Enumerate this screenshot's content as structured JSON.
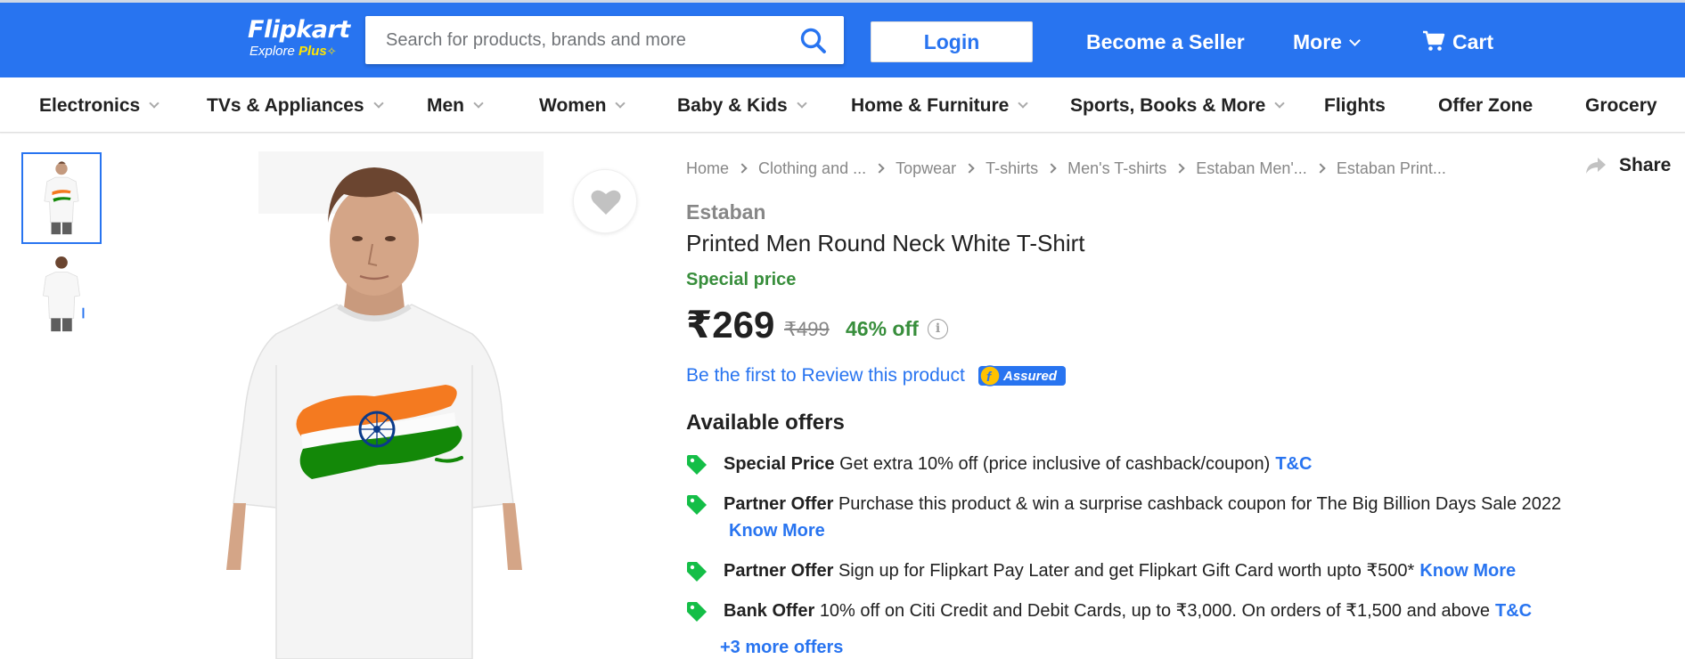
{
  "header": {
    "logo_text": "Flipkart",
    "logo_sub": "Explore",
    "logo_plus": "Plus",
    "search_placeholder": "Search for products, brands and more",
    "login_label": "Login",
    "seller_label": "Become a Seller",
    "more_label": "More",
    "cart_label": "Cart",
    "brand_color": "#2874f0"
  },
  "categories": [
    {
      "label": "Electronics",
      "dropdown": true
    },
    {
      "label": "TVs & Appliances",
      "dropdown": true
    },
    {
      "label": "Men",
      "dropdown": true
    },
    {
      "label": "Women",
      "dropdown": true
    },
    {
      "label": "Baby & Kids",
      "dropdown": true
    },
    {
      "label": "Home & Furniture",
      "dropdown": true
    },
    {
      "label": "Sports, Books & More",
      "dropdown": true
    },
    {
      "label": "Flights",
      "dropdown": false
    },
    {
      "label": "Offer Zone",
      "dropdown": false
    },
    {
      "label": "Grocery",
      "dropdown": false
    }
  ],
  "breadcrumb": [
    "Home",
    "Clothing and ...",
    "Topwear",
    "T-shirts",
    "Men's T-shirts",
    "Estaban Men'...",
    "Estaban Print..."
  ],
  "share_label": "Share",
  "product": {
    "brand": "Estaban",
    "title": "Printed Men Round Neck White T-Shirt",
    "special_label": "Special price",
    "price": "₹269",
    "mrp": "₹499",
    "discount": "46% off",
    "info_icon": "i",
    "review_link": "Be the first to Review this product",
    "assured_label": "Assured"
  },
  "offers": {
    "heading": "Available offers",
    "items": [
      {
        "type": "Special Price",
        "text": "Get extra 10% off (price inclusive of cashback/coupon)",
        "link": "T&C"
      },
      {
        "type": "Partner Offer",
        "text": "Purchase this product & win a surprise cashback coupon for The Big Billion Days Sale 2022",
        "link": "Know More"
      },
      {
        "type": "Partner Offer",
        "text": "Sign up for Flipkart Pay Later and get Flipkart Gift Card worth upto ₹500*",
        "link": "Know More"
      },
      {
        "type": "Bank Offer",
        "text": "10% off on Citi Credit and Debit Cards, up to ₹3,000. On orders of ₹1,500 and above",
        "link": "T&C"
      }
    ],
    "more_link": "+3 more offers"
  },
  "colors": {
    "accent": "#2874f0",
    "green": "#388e3c",
    "grey": "#878787",
    "tag_green": "#14be47"
  }
}
